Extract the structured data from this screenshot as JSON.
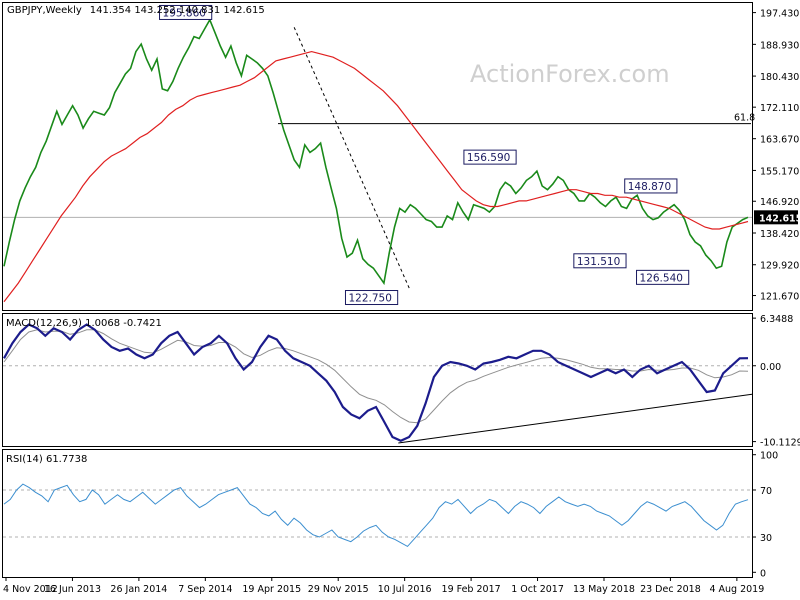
{
  "header": {
    "symbol": "GBPJPY,Weekly",
    "ohlc": "141.354 143.252 140.831 142.615",
    "watermark": "ActionForex.com"
  },
  "colors": {
    "price": "#1a8a1a",
    "ma": "#e02020",
    "macd": "#1c1c8c",
    "signal": "#909090",
    "rsi": "#3c8fd0",
    "grid": "#b0b0b0"
  },
  "chart_data": [
    {
      "type": "line",
      "title": "GBPJPY,Weekly 141.354 143.252 140.831 142.615",
      "x_ticks": [
        "4 Nov 2012",
        "16 Jun 2013",
        "26 Jan 2014",
        "7 Sep 2014",
        "19 Apr 2015",
        "29 Nov 2015",
        "10 Jul 2016",
        "19 Feb 2017",
        "1 Oct 2017",
        "13 May 2018",
        "23 Dec 2018",
        "4 Aug 2019"
      ],
      "y_ticks": [
        "197.430",
        "188.930",
        "180.430",
        "172.110",
        "163.670",
        "155.170",
        "146.920",
        "138.420",
        "129.920",
        "121.670"
      ],
      "ylim": [
        117.8,
        200.0
      ],
      "last_price": "142.615",
      "level_line": {
        "label": "61.8",
        "value": 167.7
      },
      "annotations": [
        "195.860",
        "122.750",
        "156.590",
        "148.870",
        "131.510",
        "126.540"
      ],
      "series": [
        {
          "values": [
            129.5,
            136.0,
            142.0,
            147.0,
            150.5,
            153.5,
            156.0,
            160.0,
            163.0,
            167.0,
            171.0,
            167.5,
            170.0,
            172.5,
            170.0,
            166.5,
            169.0,
            171.0,
            170.5,
            170.0,
            172.0,
            176.0,
            178.5,
            181.0,
            182.5,
            187.0,
            189.0,
            185.0,
            182.0,
            185.0,
            177.0,
            176.5,
            179.0,
            182.5,
            185.5,
            188.0,
            191.0,
            190.5,
            193.0,
            195.5,
            192.0,
            188.5,
            185.5,
            188.5,
            184.0,
            180.5,
            186.0,
            185.0,
            184.0,
            182.5,
            180.5,
            176.0,
            171.0,
            166.0,
            162.0,
            158.0,
            156.0,
            162.0,
            160.0,
            161.0,
            162.5,
            156.0,
            150.5,
            145.0,
            137.0,
            132.0,
            133.0,
            136.5,
            131.5,
            130.0,
            129.0,
            127.0,
            125.0,
            133.0,
            140.0,
            145.0,
            144.0,
            146.0,
            145.0,
            143.5,
            142.0,
            141.5,
            140.0,
            140.0,
            143.0,
            142.0,
            146.5,
            144.0,
            142.0,
            146.0,
            145.5,
            145.0,
            144.0,
            145.5,
            150.0,
            152.0,
            151.0,
            149.0,
            150.5,
            152.5,
            153.5,
            155.0,
            151.0,
            150.0,
            151.5,
            153.5,
            152.5,
            150.0,
            149.0,
            147.0,
            147.0,
            149.0,
            148.0,
            146.5,
            145.5,
            147.0,
            148.0,
            145.5,
            145.0,
            147.5,
            148.5,
            145.0,
            143.0,
            142.0,
            142.5,
            144.0,
            145.0,
            146.0,
            144.5,
            142.0,
            138.0,
            136.0,
            135.0,
            132.5,
            131.0,
            129.0,
            129.5,
            136.0,
            140.0,
            141.0,
            142.0,
            142.615
          ]
        },
        {
          "name": "MA",
          "values": [
            120.0,
            122.5,
            125.0,
            128.0,
            131.0,
            134.0,
            137.0,
            140.0,
            143.0,
            145.5,
            148.0,
            151.0,
            153.5,
            155.5,
            157.5,
            159.0,
            160.0,
            161.0,
            162.5,
            164.0,
            165.0,
            166.5,
            168.0,
            170.0,
            171.5,
            172.5,
            174.0,
            175.0,
            175.5,
            176.0,
            176.5,
            177.0,
            177.5,
            178.0,
            179.0,
            180.0,
            181.5,
            183.0,
            184.5,
            185.0,
            185.5,
            186.0,
            186.5,
            187.0,
            186.5,
            186.0,
            185.5,
            184.5,
            183.5,
            182.5,
            181.0,
            179.5,
            178.0,
            176.5,
            174.5,
            172.5,
            170.0,
            167.5,
            165.0,
            162.5,
            160.0,
            157.5,
            155.0,
            152.5,
            150.0,
            148.5,
            147.0,
            146.0,
            145.5,
            145.5,
            146.0,
            146.5,
            147.0,
            147.0,
            147.5,
            148.0,
            148.5,
            149.0,
            149.5,
            150.0,
            150.0,
            149.5,
            149.0,
            149.0,
            148.5,
            148.5,
            148.0,
            148.0,
            147.5,
            147.0,
            146.5,
            146.0,
            145.5,
            145.0,
            144.0,
            143.0,
            142.0,
            141.0,
            140.0,
            139.5,
            139.5,
            140.0,
            140.5,
            141.0,
            141.5
          ]
        }
      ]
    },
    {
      "type": "line",
      "title": "MACD(12,26,9) 1.0068 -0.7421",
      "y_ticks": [
        "6.3488",
        "0.00",
        "-10.1129"
      ],
      "ylim": [
        -10.7,
        6.9
      ],
      "series": [
        {
          "name": "MACD",
          "values": [
            1.0,
            3.0,
            4.5,
            5.5,
            5.0,
            4.0,
            5.0,
            4.5,
            3.5,
            4.8,
            5.5,
            4.8,
            3.5,
            2.5,
            2.0,
            2.3,
            1.5,
            1.0,
            1.5,
            3.0,
            4.0,
            4.5,
            3.0,
            1.5,
            2.5,
            3.0,
            4.0,
            3.0,
            1.0,
            -0.5,
            0.5,
            2.5,
            4.0,
            3.5,
            2.0,
            1.0,
            0.5,
            0.0,
            -1.0,
            -2.0,
            -3.5,
            -5.5,
            -6.5,
            -7.0,
            -6.0,
            -5.5,
            -7.5,
            -9.5,
            -10.0,
            -9.5,
            -8.0,
            -5.0,
            -1.5,
            0.0,
            0.5,
            0.3,
            0.0,
            -0.5,
            0.3,
            0.5,
            0.8,
            1.2,
            1.0,
            1.5,
            2.0,
            2.0,
            1.5,
            0.5,
            0.0,
            -0.5,
            -1.0,
            -1.5,
            -1.0,
            -0.5,
            -1.0,
            -0.5,
            -1.5,
            -0.5,
            0.0,
            -1.0,
            -0.5,
            0.0,
            0.5,
            -0.5,
            -2.0,
            -3.5,
            -3.3,
            -1.0,
            0.0,
            1.0,
            1.0068
          ]
        },
        {
          "name": "Signal",
          "values": [
            0.5,
            2.0,
            3.5,
            4.5,
            4.8,
            4.5,
            4.6,
            4.6,
            4.2,
            4.4,
            4.8,
            4.8,
            4.3,
            3.6,
            3.0,
            2.6,
            2.2,
            1.8,
            1.7,
            2.2,
            2.8,
            3.4,
            3.2,
            2.7,
            2.6,
            2.7,
            3.1,
            3.1,
            2.5,
            1.6,
            1.1,
            1.4,
            2.0,
            2.4,
            2.3,
            2.0,
            1.6,
            1.2,
            0.8,
            0.2,
            -0.6,
            -1.7,
            -2.8,
            -3.8,
            -4.3,
            -4.6,
            -5.2,
            -6.1,
            -6.9,
            -7.5,
            -7.6,
            -7.1,
            -5.9,
            -4.7,
            -3.6,
            -2.8,
            -2.2,
            -1.9,
            -1.4,
            -1.0,
            -0.6,
            -0.2,
            0.1,
            0.4,
            0.7,
            1.0,
            1.1,
            1.0,
            0.8,
            0.5,
            0.2,
            -0.2,
            -0.4,
            -0.4,
            -0.5,
            -0.5,
            -0.7,
            -0.7,
            -0.5,
            -0.6,
            -0.6,
            -0.5,
            -0.3,
            -0.3,
            -0.6,
            -1.2,
            -1.6,
            -1.5,
            -1.2,
            -0.7,
            -0.7421
          ]
        }
      ]
    },
    {
      "type": "line",
      "title": "RSI(14) 61.7738",
      "y_ticks": [
        "100",
        "70",
        "30",
        "0"
      ],
      "ylim": [
        -4.0,
        104.0
      ],
      "series": [
        {
          "name": "RSI",
          "values": [
            58,
            62,
            70,
            75,
            72,
            68,
            65,
            60,
            70,
            72,
            74,
            66,
            60,
            62,
            70,
            66,
            58,
            62,
            66,
            62,
            60,
            64,
            68,
            63,
            58,
            62,
            66,
            70,
            72,
            65,
            60,
            55,
            58,
            62,
            66,
            68,
            70,
            72,
            65,
            58,
            55,
            50,
            48,
            52,
            45,
            40,
            46,
            42,
            36,
            32,
            30,
            33,
            36,
            30,
            28,
            26,
            30,
            35,
            38,
            40,
            34,
            30,
            28,
            25,
            22,
            28,
            34,
            40,
            46,
            55,
            60,
            58,
            62,
            56,
            50,
            55,
            58,
            62,
            60,
            55,
            50,
            56,
            60,
            58,
            55,
            50,
            56,
            60,
            64,
            60,
            58,
            56,
            58,
            56,
            52,
            50,
            48,
            44,
            40,
            44,
            50,
            56,
            60,
            58,
            55,
            52,
            56,
            58,
            60,
            56,
            50,
            44,
            40,
            36,
            40,
            50,
            58,
            60,
            61.7738
          ]
        }
      ]
    }
  ]
}
